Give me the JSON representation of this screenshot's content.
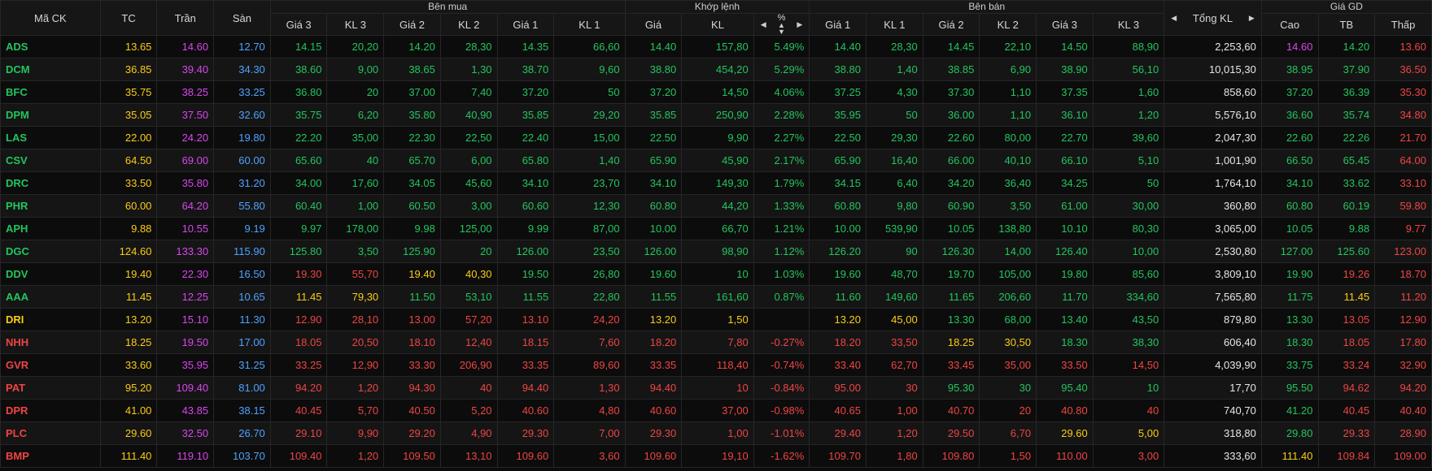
{
  "colors": {
    "up": "#22c55e",
    "down": "#ef4444",
    "ref": "#facc15",
    "ceil": "#d946ef",
    "floor": "#4ea3ff",
    "text": "#e6e6e6"
  },
  "icons": {
    "prev": "caret-left-icon",
    "next": "caret-right-icon",
    "sort": "sort-icon"
  },
  "header": {
    "symbol": "Mã CK",
    "ref": "TC",
    "ceil": "Trần",
    "floor": "Sàn",
    "groups": {
      "buy": "Bên mua",
      "match": "Khớp lệnh",
      "sell": "Bên bán",
      "history": "Giá GD"
    },
    "buy": [
      "Giá 3",
      "KL 3",
      "Giá 2",
      "KL 2",
      "Giá 1",
      "KL 1"
    ],
    "match": [
      "Giá",
      "KL",
      "%"
    ],
    "sell": [
      "Giá 1",
      "KL 1",
      "Giá 2",
      "KL 2",
      "Giá 3",
      "KL 3"
    ],
    "total": "Tổng KL",
    "history": [
      "Cao",
      "TB",
      "Thấp"
    ]
  },
  "rows": [
    {
      "sym": "ADS",
      "symc": "u",
      "tc": "13.65",
      "tran": "14.60",
      "san": "12.70",
      "b3": "14.15",
      "b3c": "u",
      "kb3": "20,20",
      "b2": "14.20",
      "b2c": "u",
      "kb2": "28,30",
      "b1": "14.35",
      "b1c": "u",
      "kb1": "66,60",
      "mp": "14.40",
      "mpc": "u",
      "mkl": "157,80",
      "pct": "5.49%",
      "s1": "14.40",
      "s1c": "u",
      "ks1": "28,30",
      "s2": "14.45",
      "s2c": "u",
      "ks2": "22,10",
      "s3": "14.50",
      "s3c": "u",
      "ks3": "88,90",
      "total": "2,253,60",
      "hi": "14.60",
      "hic": "c",
      "avg": "14.20",
      "avgc": "u",
      "lo": "13.60",
      "loc": "d"
    },
    {
      "sym": "DCM",
      "symc": "u",
      "tc": "36.85",
      "tran": "39.40",
      "san": "34.30",
      "b3": "38.60",
      "b3c": "u",
      "kb3": "9,00",
      "b2": "38.65",
      "b2c": "u",
      "kb2": "1,30",
      "b1": "38.70",
      "b1c": "u",
      "kb1": "9,60",
      "mp": "38.80",
      "mpc": "u",
      "mkl": "454,20",
      "pct": "5.29%",
      "s1": "38.80",
      "s1c": "u",
      "ks1": "1,40",
      "s2": "38.85",
      "s2c": "u",
      "ks2": "6,90",
      "s3": "38.90",
      "s3c": "u",
      "ks3": "56,10",
      "total": "10,015,30",
      "hi": "38.95",
      "hic": "u",
      "avg": "37.90",
      "avgc": "u",
      "lo": "36.50",
      "loc": "d"
    },
    {
      "sym": "BFC",
      "symc": "u",
      "tc": "35.75",
      "tran": "38.25",
      "san": "33.25",
      "b3": "36.80",
      "b3c": "u",
      "kb3": "20",
      "b2": "37.00",
      "b2c": "u",
      "kb2": "7,40",
      "b1": "37.20",
      "b1c": "u",
      "kb1": "50",
      "mp": "37.20",
      "mpc": "u",
      "mkl": "14,50",
      "pct": "4.06%",
      "s1": "37.25",
      "s1c": "u",
      "ks1": "4,30",
      "s2": "37.30",
      "s2c": "u",
      "ks2": "1,10",
      "s3": "37.35",
      "s3c": "u",
      "ks3": "1,60",
      "total": "858,60",
      "hi": "37.20",
      "hic": "u",
      "avg": "36.39",
      "avgc": "u",
      "lo": "35.30",
      "loc": "d"
    },
    {
      "sym": "DPM",
      "symc": "u",
      "tc": "35.05",
      "tran": "37.50",
      "san": "32.60",
      "b3": "35.75",
      "b3c": "u",
      "kb3": "6,20",
      "b2": "35.80",
      "b2c": "u",
      "kb2": "40,90",
      "b1": "35.85",
      "b1c": "u",
      "kb1": "29,20",
      "mp": "35.85",
      "mpc": "u",
      "mkl": "250,90",
      "pct": "2.28%",
      "s1": "35.95",
      "s1c": "u",
      "ks1": "50",
      "s2": "36.00",
      "s2c": "u",
      "ks2": "1,10",
      "s3": "36.10",
      "s3c": "u",
      "ks3": "1,20",
      "total": "5,576,10",
      "hi": "36.60",
      "hic": "u",
      "avg": "35.74",
      "avgc": "u",
      "lo": "34.80",
      "loc": "d"
    },
    {
      "sym": "LAS",
      "symc": "u",
      "tc": "22.00",
      "tran": "24.20",
      "san": "19.80",
      "b3": "22.20",
      "b3c": "u",
      "kb3": "35,00",
      "b2": "22.30",
      "b2c": "u",
      "kb2": "22,50",
      "b1": "22.40",
      "b1c": "u",
      "kb1": "15,00",
      "mp": "22.50",
      "mpc": "u",
      "mkl": "9,90",
      "pct": "2.27%",
      "s1": "22.50",
      "s1c": "u",
      "ks1": "29,30",
      "s2": "22.60",
      "s2c": "u",
      "ks2": "80,00",
      "s3": "22.70",
      "s3c": "u",
      "ks3": "39,60",
      "total": "2,047,30",
      "hi": "22.60",
      "hic": "u",
      "avg": "22.26",
      "avgc": "u",
      "lo": "21.70",
      "loc": "d"
    },
    {
      "sym": "CSV",
      "symc": "u",
      "tc": "64.50",
      "tran": "69.00",
      "san": "60.00",
      "b3": "65.60",
      "b3c": "u",
      "kb3": "40",
      "b2": "65.70",
      "b2c": "u",
      "kb2": "6,00",
      "b1": "65.80",
      "b1c": "u",
      "kb1": "1,40",
      "mp": "65.90",
      "mpc": "u",
      "mkl": "45,90",
      "pct": "2.17%",
      "s1": "65.90",
      "s1c": "u",
      "ks1": "16,40",
      "s2": "66.00",
      "s2c": "u",
      "ks2": "40,10",
      "s3": "66.10",
      "s3c": "u",
      "ks3": "5,10",
      "total": "1,001,90",
      "hi": "66.50",
      "hic": "u",
      "avg": "65.45",
      "avgc": "u",
      "lo": "64.00",
      "loc": "d"
    },
    {
      "sym": "DRC",
      "symc": "u",
      "tc": "33.50",
      "tran": "35.80",
      "san": "31.20",
      "b3": "34.00",
      "b3c": "u",
      "kb3": "17,60",
      "b2": "34.05",
      "b2c": "u",
      "kb2": "45,60",
      "b1": "34.10",
      "b1c": "u",
      "kb1": "23,70",
      "mp": "34.10",
      "mpc": "u",
      "mkl": "149,30",
      "pct": "1.79%",
      "s1": "34.15",
      "s1c": "u",
      "ks1": "6,40",
      "s2": "34.20",
      "s2c": "u",
      "ks2": "36,40",
      "s3": "34.25",
      "s3c": "u",
      "ks3": "50",
      "total": "1,764,10",
      "hi": "34.10",
      "hic": "u",
      "avg": "33.62",
      "avgc": "u",
      "lo": "33.10",
      "loc": "d"
    },
    {
      "sym": "PHR",
      "symc": "u",
      "tc": "60.00",
      "tran": "64.20",
      "san": "55.80",
      "b3": "60.40",
      "b3c": "u",
      "kb3": "1,00",
      "b2": "60.50",
      "b2c": "u",
      "kb2": "3,00",
      "b1": "60.60",
      "b1c": "u",
      "kb1": "12,30",
      "mp": "60.80",
      "mpc": "u",
      "mkl": "44,20",
      "pct": "1.33%",
      "s1": "60.80",
      "s1c": "u",
      "ks1": "9,80",
      "s2": "60.90",
      "s2c": "u",
      "ks2": "3,50",
      "s3": "61.00",
      "s3c": "u",
      "ks3": "30,00",
      "total": "360,80",
      "hi": "60.80",
      "hic": "u",
      "avg": "60.19",
      "avgc": "u",
      "lo": "59.80",
      "loc": "d"
    },
    {
      "sym": "APH",
      "symc": "u",
      "tc": "9.88",
      "tran": "10.55",
      "san": "9.19",
      "b3": "9.97",
      "b3c": "u",
      "kb3": "178,00",
      "b2": "9.98",
      "b2c": "u",
      "kb2": "125,00",
      "b1": "9.99",
      "b1c": "u",
      "kb1": "87,00",
      "mp": "10.00",
      "mpc": "u",
      "mkl": "66,70",
      "pct": "1.21%",
      "s1": "10.00",
      "s1c": "u",
      "ks1": "539,90",
      "s2": "10.05",
      "s2c": "u",
      "ks2": "138,80",
      "s3": "10.10",
      "s3c": "u",
      "ks3": "80,30",
      "total": "3,065,00",
      "hi": "10.05",
      "hic": "u",
      "avg": "9.88",
      "avgc": "u",
      "lo": "9.77",
      "loc": "d"
    },
    {
      "sym": "DGC",
      "symc": "u",
      "tc": "124.60",
      "tran": "133.30",
      "san": "115.90",
      "b3": "125.80",
      "b3c": "u",
      "kb3": "3,50",
      "b2": "125.90",
      "b2c": "u",
      "kb2": "20",
      "b1": "126.00",
      "b1c": "u",
      "kb1": "23,50",
      "mp": "126.00",
      "mpc": "u",
      "mkl": "98,90",
      "pct": "1.12%",
      "s1": "126.20",
      "s1c": "u",
      "ks1": "90",
      "s2": "126.30",
      "s2c": "u",
      "ks2": "14,00",
      "s3": "126.40",
      "s3c": "u",
      "ks3": "10,00",
      "total": "2,530,80",
      "hi": "127.00",
      "hic": "u",
      "avg": "125.60",
      "avgc": "u",
      "lo": "123.00",
      "loc": "d"
    },
    {
      "sym": "DDV",
      "symc": "u",
      "tc": "19.40",
      "tran": "22.30",
      "san": "16.50",
      "b3": "19.30",
      "b3c": "d",
      "kb3": "55,70",
      "b2": "19.40",
      "b2c": "r",
      "kb2": "40,30",
      "b1": "19.50",
      "b1c": "u",
      "kb1": "26,80",
      "mp": "19.60",
      "mpc": "u",
      "mkl": "10",
      "pct": "1.03%",
      "s1": "19.60",
      "s1c": "u",
      "ks1": "48,70",
      "s2": "19.70",
      "s2c": "u",
      "ks2": "105,00",
      "s3": "19.80",
      "s3c": "u",
      "ks3": "85,60",
      "total": "3,809,10",
      "hi": "19.90",
      "hic": "u",
      "avg": "19.26",
      "avgc": "d",
      "lo": "18.70",
      "loc": "d"
    },
    {
      "sym": "AAA",
      "symc": "u",
      "tc": "11.45",
      "tran": "12.25",
      "san": "10.65",
      "b3": "11.45",
      "b3c": "r",
      "kb3": "79,30",
      "b2": "11.50",
      "b2c": "u",
      "kb2": "53,10",
      "b1": "11.55",
      "b1c": "u",
      "kb1": "22,80",
      "mp": "11.55",
      "mpc": "u",
      "mkl": "161,60",
      "pct": "0.87%",
      "s1": "11.60",
      "s1c": "u",
      "ks1": "149,60",
      "s2": "11.65",
      "s2c": "u",
      "ks2": "206,60",
      "s3": "11.70",
      "s3c": "u",
      "ks3": "334,60",
      "total": "7,565,80",
      "hi": "11.75",
      "hic": "u",
      "avg": "11.45",
      "avgc": "r",
      "lo": "11.20",
      "loc": "d"
    },
    {
      "sym": "DRI",
      "symc": "r",
      "tc": "13.20",
      "tran": "15.10",
      "san": "11.30",
      "b3": "12.90",
      "b3c": "d",
      "kb3": "28,10",
      "b2": "13.00",
      "b2c": "d",
      "kb2": "57,20",
      "b1": "13.10",
      "b1c": "d",
      "kb1": "24,20",
      "mp": "13.20",
      "mpc": "r",
      "mkl": "1,50",
      "pct": "",
      "s1": "13.20",
      "s1c": "r",
      "ks1": "45,00",
      "s2": "13.30",
      "s2c": "u",
      "ks2": "68,00",
      "s3": "13.40",
      "s3c": "u",
      "ks3": "43,50",
      "total": "879,80",
      "hi": "13.30",
      "hic": "u",
      "avg": "13.05",
      "avgc": "d",
      "lo": "12.90",
      "loc": "d"
    },
    {
      "sym": "NHH",
      "symc": "d",
      "tc": "18.25",
      "tran": "19.50",
      "san": "17.00",
      "b3": "18.05",
      "b3c": "d",
      "kb3": "20,50",
      "b2": "18.10",
      "b2c": "d",
      "kb2": "12,40",
      "b1": "18.15",
      "b1c": "d",
      "kb1": "7,60",
      "mp": "18.20",
      "mpc": "d",
      "mkl": "7,80",
      "pct": "-0.27%",
      "s1": "18.20",
      "s1c": "d",
      "ks1": "33,50",
      "s2": "18.25",
      "s2c": "r",
      "ks2": "30,50",
      "s3": "18.30",
      "s3c": "u",
      "ks3": "38,30",
      "total": "606,40",
      "hi": "18.30",
      "hic": "u",
      "avg": "18.05",
      "avgc": "d",
      "lo": "17.80",
      "loc": "d"
    },
    {
      "sym": "GVR",
      "symc": "d",
      "tc": "33.60",
      "tran": "35.95",
      "san": "31.25",
      "b3": "33.25",
      "b3c": "d",
      "kb3": "12,90",
      "b2": "33.30",
      "b2c": "d",
      "kb2": "206,90",
      "b1": "33.35",
      "b1c": "d",
      "kb1": "89,60",
      "mp": "33.35",
      "mpc": "d",
      "mkl": "118,40",
      "pct": "-0.74%",
      "s1": "33.40",
      "s1c": "d",
      "ks1": "62,70",
      "s2": "33.45",
      "s2c": "d",
      "ks2": "35,00",
      "s3": "33.50",
      "s3c": "d",
      "ks3": "14,50",
      "total": "4,039,90",
      "hi": "33.75",
      "hic": "u",
      "avg": "33.24",
      "avgc": "d",
      "lo": "32.90",
      "loc": "d"
    },
    {
      "sym": "PAT",
      "symc": "d",
      "tc": "95.20",
      "tran": "109.40",
      "san": "81.00",
      "b3": "94.20",
      "b3c": "d",
      "kb3": "1,20",
      "b2": "94.30",
      "b2c": "d",
      "kb2": "40",
      "b1": "94.40",
      "b1c": "d",
      "kb1": "1,30",
      "mp": "94.40",
      "mpc": "d",
      "mkl": "10",
      "pct": "-0.84%",
      "s1": "95.00",
      "s1c": "d",
      "ks1": "30",
      "s2": "95.30",
      "s2c": "u",
      "ks2": "30",
      "s3": "95.40",
      "s3c": "u",
      "ks3": "10",
      "total": "17,70",
      "hi": "95.50",
      "hic": "u",
      "avg": "94.62",
      "avgc": "d",
      "lo": "94.20",
      "loc": "d"
    },
    {
      "sym": "DPR",
      "symc": "d",
      "tc": "41.00",
      "tran": "43.85",
      "san": "38.15",
      "b3": "40.45",
      "b3c": "d",
      "kb3": "5,70",
      "b2": "40.50",
      "b2c": "d",
      "kb2": "5,20",
      "b1": "40.60",
      "b1c": "d",
      "kb1": "4,80",
      "mp": "40.60",
      "mpc": "d",
      "mkl": "37,00",
      "pct": "-0.98%",
      "s1": "40.65",
      "s1c": "d",
      "ks1": "1,00",
      "s2": "40.70",
      "s2c": "d",
      "ks2": "20",
      "s3": "40.80",
      "s3c": "d",
      "ks3": "40",
      "total": "740,70",
      "hi": "41.20",
      "hic": "u",
      "avg": "40.45",
      "avgc": "d",
      "lo": "40.40",
      "loc": "d"
    },
    {
      "sym": "PLC",
      "symc": "d",
      "tc": "29.60",
      "tran": "32.50",
      "san": "26.70",
      "b3": "29.10",
      "b3c": "d",
      "kb3": "9,90",
      "b2": "29.20",
      "b2c": "d",
      "kb2": "4,90",
      "b1": "29.30",
      "b1c": "d",
      "kb1": "7,00",
      "mp": "29.30",
      "mpc": "d",
      "mkl": "1,00",
      "pct": "-1.01%",
      "s1": "29.40",
      "s1c": "d",
      "ks1": "1,20",
      "s2": "29.50",
      "s2c": "d",
      "ks2": "6,70",
      "s3": "29.60",
      "s3c": "r",
      "ks3": "5,00",
      "total": "318,80",
      "hi": "29.80",
      "hic": "u",
      "avg": "29.33",
      "avgc": "d",
      "lo": "28.90",
      "loc": "d"
    },
    {
      "sym": "BMP",
      "symc": "d",
      "tc": "111.40",
      "tran": "119.10",
      "san": "103.70",
      "b3": "109.40",
      "b3c": "d",
      "kb3": "1,20",
      "b2": "109.50",
      "b2c": "d",
      "kb2": "13,10",
      "b1": "109.60",
      "b1c": "d",
      "kb1": "3,60",
      "mp": "109.60",
      "mpc": "d",
      "mkl": "19,10",
      "pct": "-1.62%",
      "s1": "109.70",
      "s1c": "d",
      "ks1": "1,80",
      "s2": "109.80",
      "s2c": "d",
      "ks2": "1,50",
      "s3": "110.00",
      "s3c": "d",
      "ks3": "3,00",
      "total": "333,60",
      "hi": "111.40",
      "hic": "r",
      "avg": "109.84",
      "avgc": "d",
      "lo": "109.00",
      "loc": "d"
    }
  ]
}
